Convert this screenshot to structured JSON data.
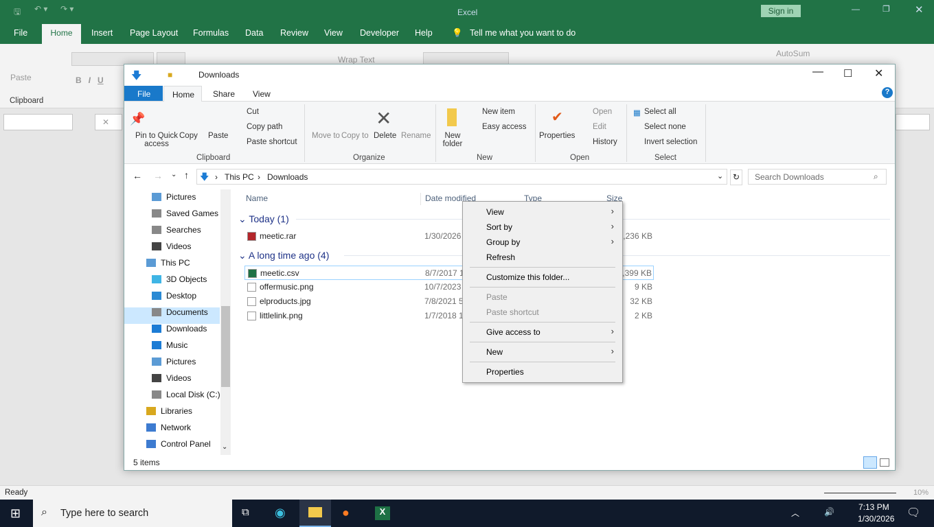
{
  "excel": {
    "title": "Excel",
    "sign_in": "Sign in",
    "tabs": [
      "File",
      "Home",
      "Insert",
      "Page Layout",
      "Formulas",
      "Data",
      "Review",
      "View",
      "Developer",
      "Help"
    ],
    "tell_me": "Tell me what you want to do",
    "paste": "Paste",
    "clipboard": "Clipboard",
    "wrap_text": "Wrap Text",
    "autosum": "AutoSum",
    "status_ready": "Ready",
    "zoom": "10%"
  },
  "explorer": {
    "title": "Downloads",
    "tabs": [
      "File",
      "Home",
      "Share",
      "View"
    ],
    "ribbon": {
      "pin": "Pin to Quick access",
      "copy": "Copy",
      "paste": "Paste",
      "cut": "Cut",
      "copy_path": "Copy path",
      "paste_shortcut": "Paste shortcut",
      "clipboard": "Clipboard",
      "move_to": "Move to",
      "copy_to": "Copy to",
      "delete": "Delete",
      "rename": "Rename",
      "organize": "Organize",
      "new_item": "New item",
      "easy_access": "Easy access",
      "new_folder": "New folder",
      "new": "New",
      "properties": "Properties",
      "open": "Open",
      "edit": "Edit",
      "history": "History",
      "open_group": "Open",
      "select_all": "Select all",
      "select_none": "Select none",
      "invert_selection": "Invert selection",
      "select": "Select"
    },
    "breadcrumb": [
      "This PC",
      "Downloads"
    ],
    "search_placeholder": "Search Downloads",
    "nav": [
      "Pictures",
      "Saved Games",
      "Searches",
      "Videos",
      "This PC",
      "3D Objects",
      "Desktop",
      "Documents",
      "Downloads",
      "Music",
      "Pictures",
      "Videos",
      "Local Disk (C:)",
      "Libraries",
      "Network",
      "Control Panel"
    ],
    "columns": [
      "Name",
      "Date modified",
      "Type",
      "Size"
    ],
    "groups": [
      {
        "label": "Today (1)"
      },
      {
        "label": "A long time ago (4)"
      }
    ],
    "files": [
      {
        "name": "meetic.rar",
        "date": "1/30/2026",
        "size": "1,236 KB"
      },
      {
        "name": "meetic.csv",
        "date": "8/7/2017 1",
        "size": "3,399 KB"
      },
      {
        "name": "offermusic.png",
        "date": "10/7/2023",
        "size": "9 KB"
      },
      {
        "name": "elproducts.jpg",
        "date": "7/8/2021 5",
        "size": "32 KB"
      },
      {
        "name": "littlelink.png",
        "date": "1/7/2018 1",
        "size": "2 KB"
      }
    ],
    "status": "5 items"
  },
  "context_menu": [
    "View",
    "Sort by",
    "Group by",
    "Refresh",
    "Customize this folder...",
    "Paste",
    "Paste shortcut",
    "Give access to",
    "New",
    "Properties"
  ],
  "taskbar": {
    "search": "Type here to search",
    "time": "7:13 PM",
    "date": "1/30/2026"
  }
}
